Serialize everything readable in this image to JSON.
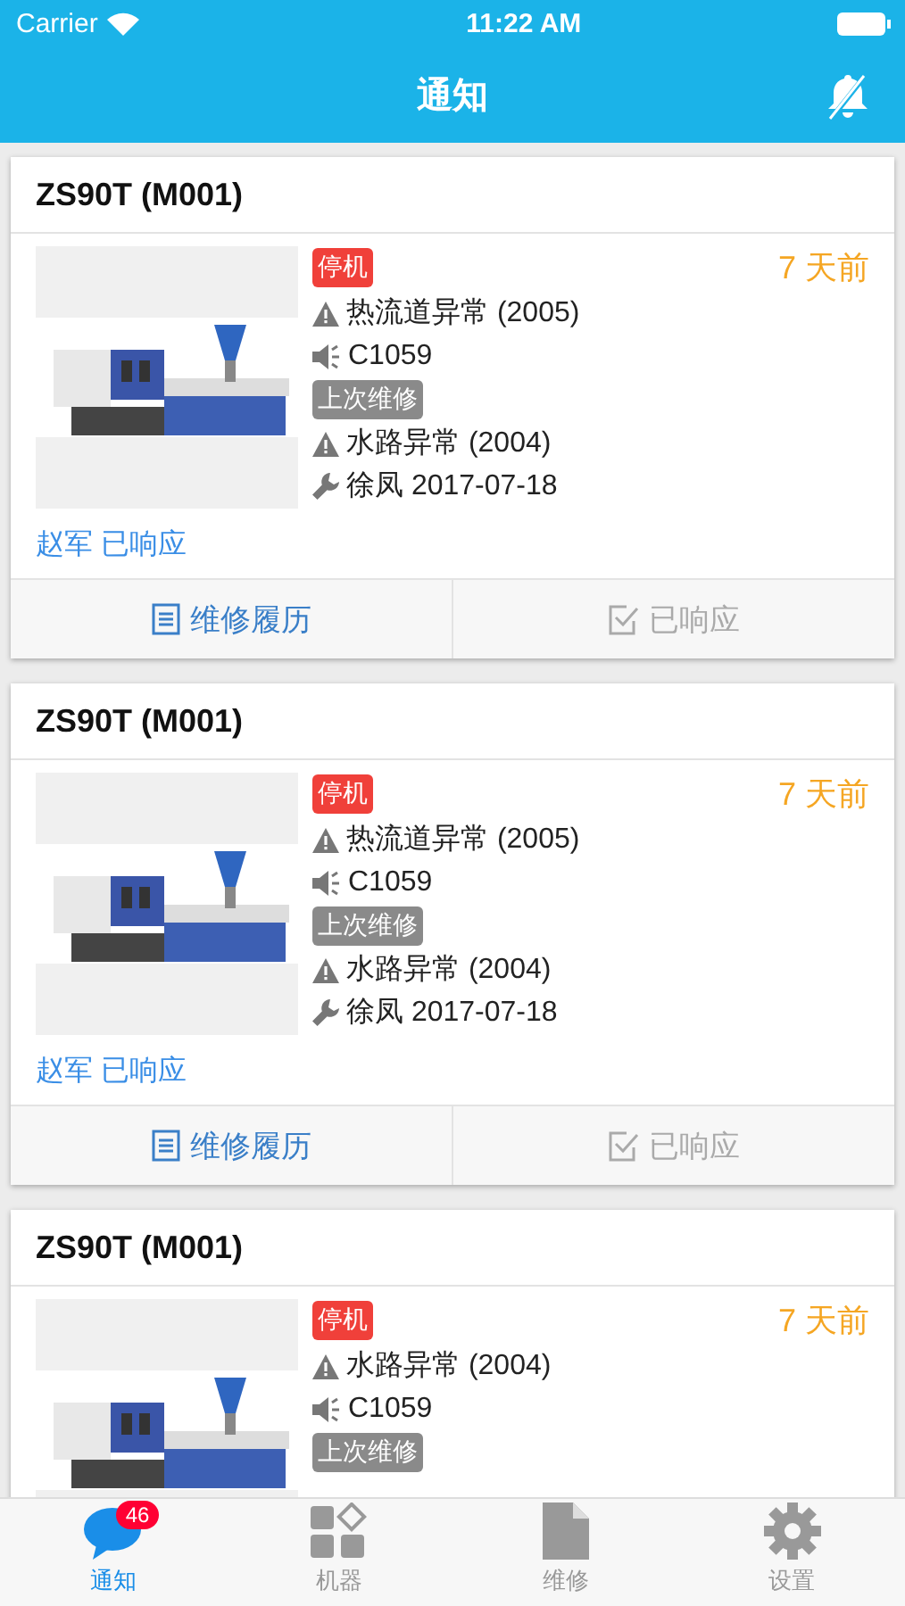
{
  "status_bar": {
    "carrier": "Carrier",
    "time": "11:22 AM"
  },
  "nav": {
    "title": "通知",
    "bell_muted": true
  },
  "cards": [
    {
      "title": "ZS90T (M001)",
      "age": "7 天前",
      "lines": [
        {
          "kind": "status",
          "text": "停机"
        },
        {
          "kind": "alarm",
          "text": "热流道异常 (2005)"
        },
        {
          "kind": "code",
          "text": "C1059"
        },
        {
          "kind": "tag",
          "text": "上次维修"
        },
        {
          "kind": "alarm",
          "text": "水路异常 (2004)"
        },
        {
          "kind": "repair",
          "text": "徐凤 2017-07-18"
        }
      ],
      "responder": "赵军 已响应",
      "actions": [
        {
          "kind": "history",
          "label": "维修履历",
          "disabled": false
        },
        {
          "kind": "respond",
          "label": "已响应",
          "disabled": true
        }
      ]
    },
    {
      "title": "ZS90T (M001)",
      "age": "7 天前",
      "lines": [
        {
          "kind": "status",
          "text": "停机"
        },
        {
          "kind": "alarm",
          "text": "热流道异常 (2005)"
        },
        {
          "kind": "code",
          "text": "C1059"
        },
        {
          "kind": "tag",
          "text": "上次维修"
        },
        {
          "kind": "alarm",
          "text": "水路异常 (2004)"
        },
        {
          "kind": "repair",
          "text": "徐凤 2017-07-18"
        }
      ],
      "responder": "赵军 已响应",
      "actions": [
        {
          "kind": "history",
          "label": "维修履历",
          "disabled": false
        },
        {
          "kind": "respond",
          "label": "已响应",
          "disabled": true
        }
      ]
    },
    {
      "title": "ZS90T (M001)",
      "age": "7 天前",
      "lines": [
        {
          "kind": "status",
          "text": "停机"
        },
        {
          "kind": "alarm",
          "text": "水路异常 (2004)"
        },
        {
          "kind": "code",
          "text": "C1059"
        },
        {
          "kind": "tag",
          "text": "上次维修"
        }
      ]
    }
  ],
  "tab_bar": [
    {
      "kind": "chat",
      "label": "通知",
      "selected": true,
      "badge": "46"
    },
    {
      "kind": "grid",
      "label": "机器",
      "selected": false
    },
    {
      "kind": "doc",
      "label": "维修",
      "selected": false
    },
    {
      "kind": "gear",
      "label": "设置",
      "selected": false
    }
  ]
}
